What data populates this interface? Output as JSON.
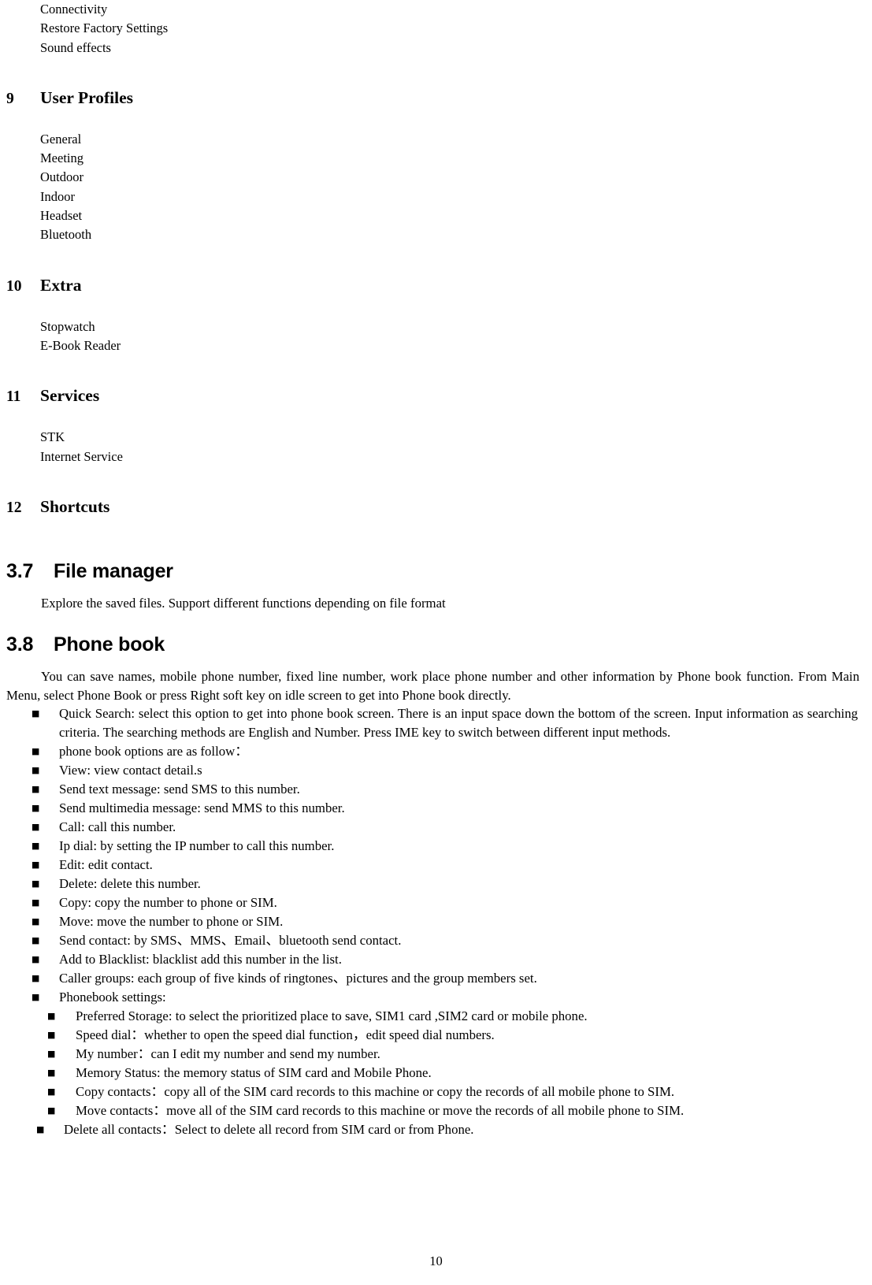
{
  "document": {
    "page_number": "10",
    "top_menu_items": [
      "Connectivity",
      "Restore Factory Settings",
      "Sound effects"
    ],
    "chapters": [
      {
        "number": "9",
        "title": "User Profiles",
        "items": [
          "General",
          "Meeting",
          "Outdoor",
          "Indoor",
          "Headset",
          "Bluetooth"
        ]
      },
      {
        "number": "10",
        "title": "Extra",
        "items": [
          "Stopwatch",
          "E-Book Reader"
        ]
      },
      {
        "number": "11",
        "title": "Services",
        "items": [
          "STK",
          "Internet Service"
        ]
      },
      {
        "number": "12",
        "title": "Shortcuts",
        "items": []
      }
    ],
    "sections": [
      {
        "number": "3.7",
        "title": "File manager",
        "body": "Explore the saved files. Support different functions depending on file format"
      },
      {
        "number": "3.8",
        "title": "Phone book",
        "body": "You can save names, mobile phone number, fixed line number, work place phone number and other information by Phone book function. From Main Menu, select Phone Book or press Right soft key on idle screen to get into Phone book directly."
      }
    ],
    "bullet_symbol": "■",
    "phonebook_bullets": [
      "Quick Search: select this option to get into phone book screen. There is an input space down the bottom of the screen. Input information as searching criteria. The searching methods are English and Number. Press IME key to switch between different input methods.",
      "phone book options are as follow：",
      "View: view contact detail.s",
      "Send text message: send SMS to this number.",
      "Send multimedia message: send MMS to this number.",
      "Call: call this number.",
      "Ip dial: by setting the IP number to call this number.",
      "Edit: edit contact.",
      "Delete: delete this number.",
      "Copy: copy the number to phone or SIM.",
      "Move: move the number to phone or SIM.",
      "Send contact: by SMS、MMS、Email、bluetooth send contact.",
      "Add to Blacklist: blacklist add this number in the list.",
      "Caller groups: each group of five kinds of ringtones、pictures and the group members set.",
      "Phonebook settings:"
    ],
    "phonebook_settings_bullets": [
      "Preferred Storage: to select the prioritized place to save, SIM1 card ,SIM2 card or mobile phone.",
      "Speed dial：whether to open the speed dial function，edit speed dial numbers.",
      "My number：can I edit my number and send my number.",
      "Memory Status: the memory status of SIM card and Mobile Phone.",
      "Copy contacts：copy all of the SIM card records to this machine or copy the records of all mobile phone to SIM.",
      "Move contacts：move all of the SIM card records to this machine or move the records of all mobile phone to SIM."
    ],
    "final_bullet": "Delete all contacts：Select to delete all record from SIM card or from Phone."
  }
}
